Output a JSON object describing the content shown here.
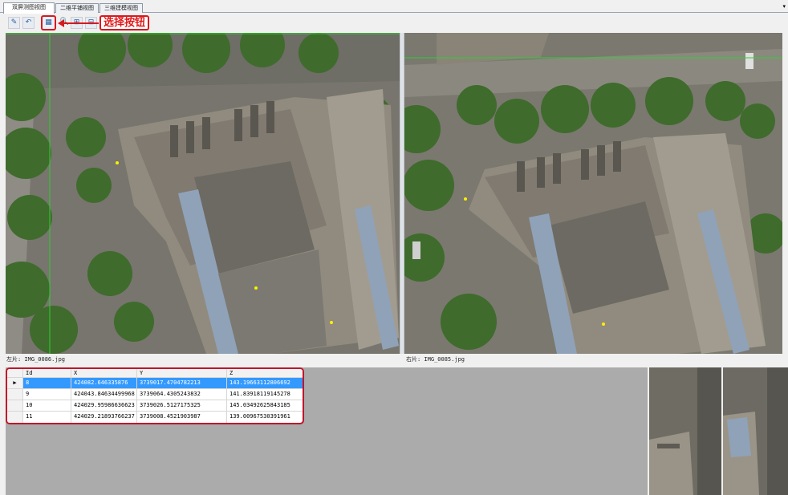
{
  "tabs": [
    "双屏测图视图",
    "二维平铺视图",
    "三维建模视图"
  ],
  "toolbar": {
    "callout": "选择按钮",
    "icons": [
      "edit-icon",
      "undo-icon",
      "select-grid-icon",
      "zoom-icon",
      "zoom-in-icon",
      "zoom-out-icon"
    ]
  },
  "panes": {
    "left_caption": "左片: IMG_0086.jpg",
    "right_caption": "右片: IMG_0085.jpg"
  },
  "table": {
    "columns": [
      "Id",
      "X",
      "Y",
      "Z"
    ],
    "rows": [
      {
        "id": "8",
        "x": "424082.646335876",
        "y": "3739017.4704782213",
        "z": "143.19663112806692"
      },
      {
        "id": "9",
        "x": "424043.84634499968",
        "y": "3739064.4305243832",
        "z": "141.83918119145278"
      },
      {
        "id": "10",
        "x": "424029.95986636623",
        "y": "3739026.5127175325",
        "z": "145.03492625843185"
      },
      {
        "id": "11",
        "x": "424029.21893766237",
        "y": "3739008.4521903987",
        "z": "139.00967530391961"
      }
    ],
    "selected_row": 0
  },
  "colors": {
    "accent_red": "#d71920",
    "selection": "#3399ff",
    "crosshair": "#2fd12f",
    "marker": "#ffee00"
  }
}
